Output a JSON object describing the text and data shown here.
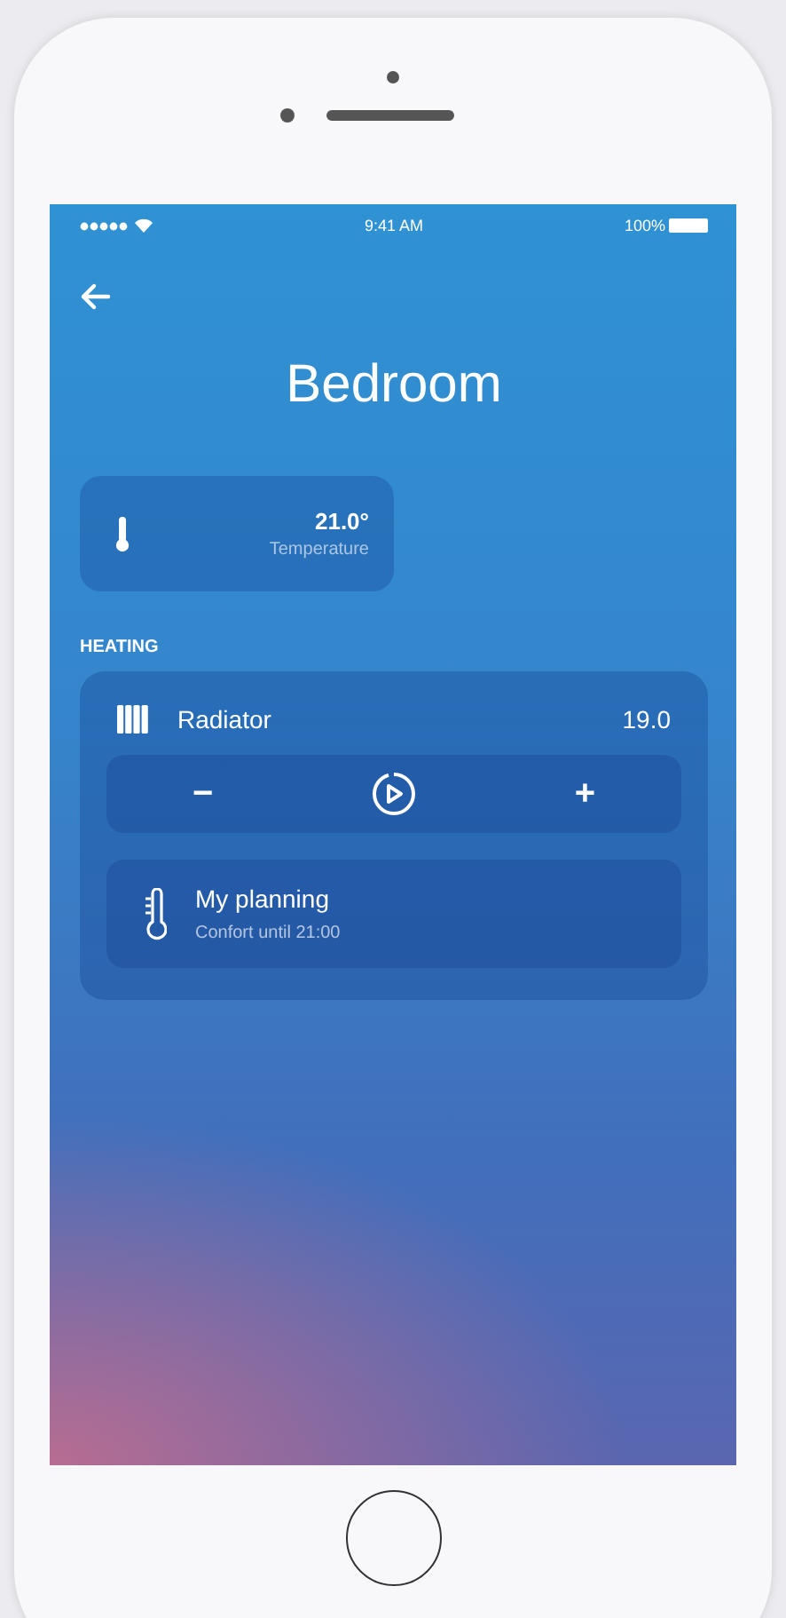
{
  "status_bar": {
    "time": "9:41 AM",
    "battery": "100%"
  },
  "header": {
    "title": "Bedroom"
  },
  "temperature_card": {
    "value": "21.0°",
    "label": "Temperature"
  },
  "heating": {
    "title": "HEATING",
    "device": {
      "name": "Radiator",
      "value": "19.0"
    },
    "controls": [
      {
        "kind": "minus",
        "label": "−"
      },
      {
        "kind": "mode"
      },
      {
        "kind": "plus",
        "label": "+"
      }
    ],
    "planning": {
      "title": "My planning",
      "subtitle": "Confort until 21:00"
    }
  }
}
